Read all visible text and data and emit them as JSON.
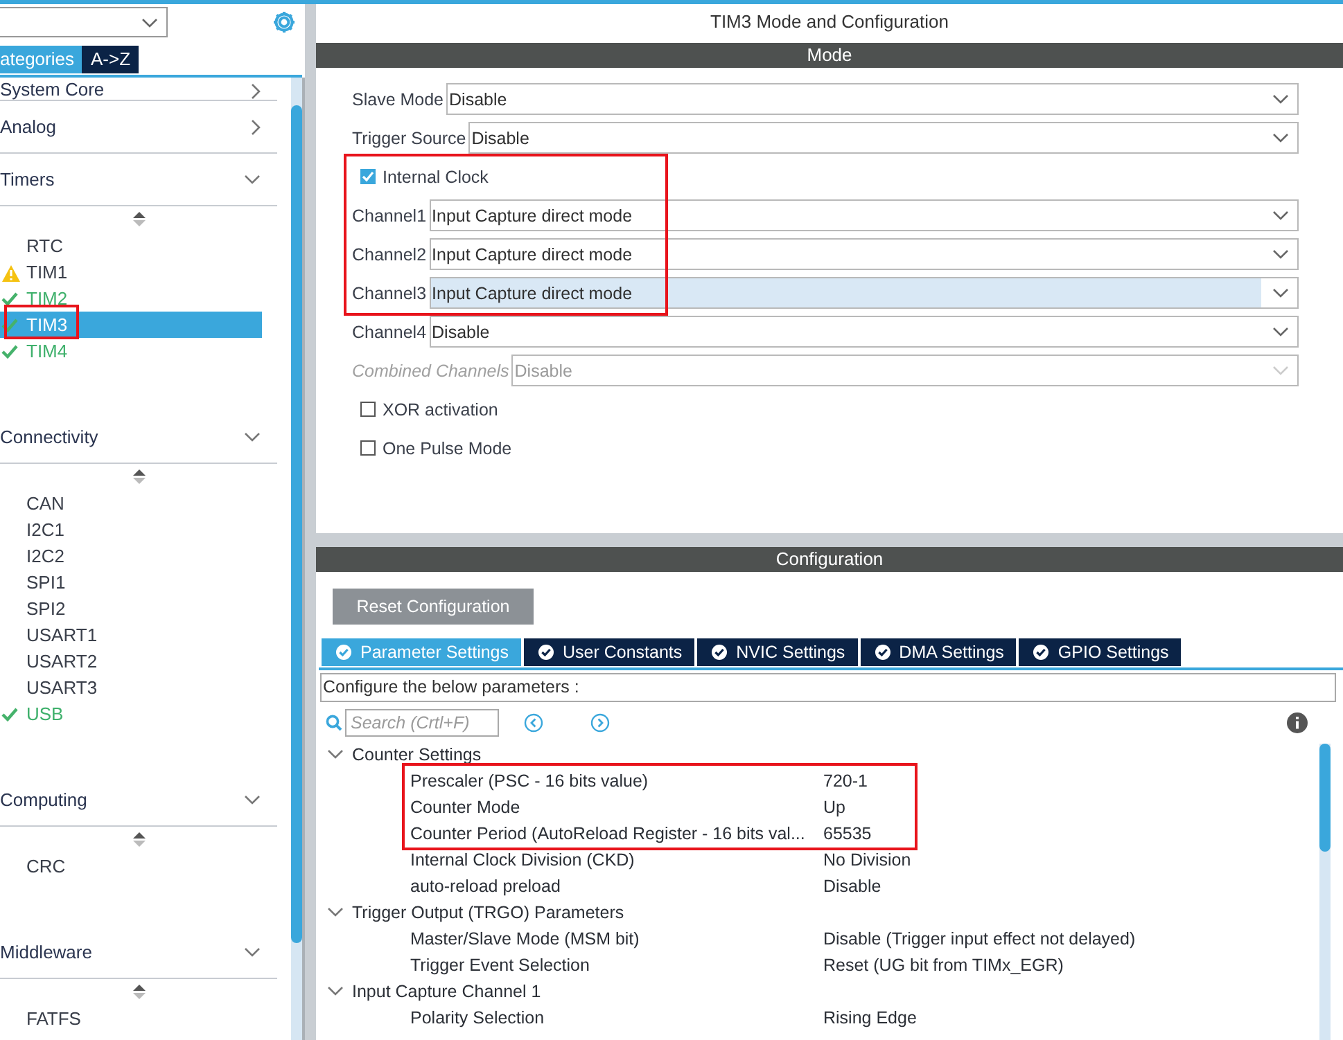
{
  "sidebar": {
    "tabs": [
      {
        "label": "ategories",
        "selected": true
      },
      {
        "label": "A->Z",
        "selected": false
      }
    ],
    "categories": [
      {
        "label": "System Core",
        "expanded": false
      },
      {
        "label": "Analog",
        "expanded": false
      },
      {
        "label": "Timers",
        "expanded": true,
        "items": [
          {
            "label": "RTC",
            "warning": false,
            "configured": false,
            "selected": false,
            "highlighted": false
          },
          {
            "label": "TIM1",
            "warning": true,
            "configured": false,
            "selected": false,
            "highlighted": false
          },
          {
            "label": "TIM2",
            "warning": false,
            "configured": true,
            "selected": false,
            "highlighted": false
          },
          {
            "label": "TIM3",
            "warning": false,
            "configured": true,
            "selected": true,
            "highlighted": true
          },
          {
            "label": "TIM4",
            "warning": false,
            "configured": true,
            "selected": false,
            "highlighted": false
          }
        ]
      },
      {
        "label": "Connectivity",
        "expanded": true,
        "items": [
          {
            "label": "CAN",
            "warning": false,
            "configured": false,
            "selected": false,
            "highlighted": false
          },
          {
            "label": "I2C1",
            "warning": false,
            "configured": false,
            "selected": false,
            "highlighted": false
          },
          {
            "label": "I2C2",
            "warning": false,
            "configured": false,
            "selected": false,
            "highlighted": false
          },
          {
            "label": "SPI1",
            "warning": false,
            "configured": false,
            "selected": false,
            "highlighted": false
          },
          {
            "label": "SPI2",
            "warning": false,
            "configured": false,
            "selected": false,
            "highlighted": false
          },
          {
            "label": "USART1",
            "warning": false,
            "configured": false,
            "selected": false,
            "highlighted": false
          },
          {
            "label": "USART2",
            "warning": false,
            "configured": false,
            "selected": false,
            "highlighted": false
          },
          {
            "label": "USART3",
            "warning": false,
            "configured": false,
            "selected": false,
            "highlighted": false
          },
          {
            "label": "USB",
            "warning": false,
            "configured": true,
            "selected": false,
            "highlighted": false
          }
        ]
      },
      {
        "label": "Computing",
        "expanded": true,
        "items": [
          {
            "label": "CRC",
            "warning": false,
            "configured": false,
            "selected": false,
            "highlighted": false
          }
        ]
      },
      {
        "label": "Middleware",
        "expanded": true,
        "items": [
          {
            "label": "FATFS",
            "warning": false,
            "configured": false,
            "selected": false,
            "highlighted": false
          }
        ]
      }
    ]
  },
  "mode": {
    "title": "TIM3 Mode and Configuration",
    "section": "Mode",
    "rows": [
      {
        "kind": "select",
        "label": "Slave Mode",
        "value": "Disable",
        "disabled": false,
        "focused": false,
        "highlighted": false
      },
      {
        "kind": "select",
        "label": "Trigger Source",
        "value": "Disable",
        "disabled": false,
        "focused": false,
        "highlighted": false
      },
      {
        "kind": "checkbox",
        "label": "Internal Clock",
        "checked": true,
        "highlighted": true
      },
      {
        "kind": "select",
        "label": "Channel1",
        "value": "Input Capture direct mode",
        "disabled": false,
        "focused": false,
        "highlighted": true
      },
      {
        "kind": "select",
        "label": "Channel2",
        "value": "Input Capture direct mode",
        "disabled": false,
        "focused": false,
        "highlighted": true
      },
      {
        "kind": "select",
        "label": "Channel3",
        "value": "Input Capture direct mode",
        "disabled": false,
        "focused": true,
        "highlighted": true
      },
      {
        "kind": "select",
        "label": "Channel4",
        "value": "Disable",
        "disabled": false,
        "focused": false,
        "highlighted": false
      },
      {
        "kind": "select",
        "label": "Combined Channels",
        "value": "Disable",
        "disabled": true,
        "focused": false,
        "highlighted": false
      },
      {
        "kind": "checkbox",
        "label": "XOR activation",
        "checked": false,
        "highlighted": false
      },
      {
        "kind": "checkbox",
        "label": "One Pulse Mode",
        "checked": false,
        "highlighted": false
      }
    ]
  },
  "configuration": {
    "section": "Configuration",
    "reset_button": "Reset Configuration",
    "tabs": [
      {
        "label": "Parameter Settings",
        "selected": true
      },
      {
        "label": "User Constants",
        "selected": false
      },
      {
        "label": "NVIC Settings",
        "selected": false
      },
      {
        "label": "DMA Settings",
        "selected": false
      },
      {
        "label": "GPIO Settings",
        "selected": false
      }
    ],
    "description": "Configure the below parameters :",
    "search": {
      "placeholder": "Search (Crtl+F)"
    },
    "groups": [
      {
        "label": "Counter Settings",
        "expanded": true,
        "children": [
          {
            "name": "Prescaler (PSC - 16 bits value)",
            "value": "720-1",
            "highlighted": true
          },
          {
            "name": "Counter Mode",
            "value": "Up",
            "highlighted": true
          },
          {
            "name": "Counter Period (AutoReload Register - 16 bits val...",
            "value": "65535",
            "highlighted": true
          },
          {
            "name": "Internal Clock Division (CKD)",
            "value": "No Division",
            "highlighted": false
          },
          {
            "name": "auto-reload preload",
            "value": "Disable",
            "highlighted": false
          }
        ]
      },
      {
        "label": "Trigger Output (TRGO) Parameters",
        "expanded": true,
        "children": [
          {
            "name": "Master/Slave Mode (MSM bit)",
            "value": "Disable (Trigger input effect not delayed)",
            "highlighted": false
          },
          {
            "name": "Trigger Event Selection",
            "value": "Reset (UG bit from TIMx_EGR)",
            "highlighted": false
          }
        ]
      },
      {
        "label": "Input Capture Channel 1",
        "expanded": true,
        "children": [
          {
            "name": "Polarity Selection",
            "value": "Rising Edge",
            "highlighted": false
          }
        ]
      }
    ]
  }
}
